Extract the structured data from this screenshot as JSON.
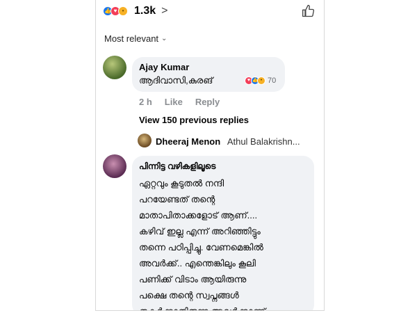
{
  "reactions_bar": {
    "count": "1.3k",
    "chevron": ">"
  },
  "sort": {
    "label": "Most relevant"
  },
  "comment1": {
    "author": "Ajay Kumar",
    "text": "ആദിവാസി,കുരങ്",
    "reaction_count": "70",
    "time": "2 h",
    "like": "Like",
    "reply": "Reply"
  },
  "view_previous": "View 150 previous replies",
  "reply_preview": {
    "author": "Dheeraj Menon",
    "mention": "Athul Balakrishn..."
  },
  "comment2": {
    "author": "പിന്നിട്ട വഴികളിലൂടെ",
    "lines": [
      "ഏറ്റവും കൂടുതൽ നന്ദി",
      "പറയേണ്ടത് തന്റെ",
      "മാതാപിതാക്കളോട് ആണ്....",
      "കഴിവ് ഇല്ല എന്ന് അറിഞ്ഞിട്ടും",
      "തന്നെ പഠിപ്പിച്ചു. വേണമെങ്കിൽ",
      "അവർക്ക്.. എന്തെങ്കിലും കൂലി",
      "പണിക്ക് വിടാം ആയിരുന്നു",
      "പക്ഷെ തന്റെ സ്വപ്നങ്ങൾ",
      "തകർക്കാതിരുന്ന അവർക്കാണ്"
    ]
  },
  "colors": {
    "like": "#1877f2",
    "love": "#f33e58",
    "wow": "#f7b125",
    "bubble": "#f0f2f5",
    "muted": "#65676b"
  },
  "icons": [
    "like-reaction-icon",
    "love-reaction-icon",
    "wow-reaction-icon",
    "thumbs-up-icon",
    "chevron-right-icon",
    "chevron-down-icon"
  ]
}
